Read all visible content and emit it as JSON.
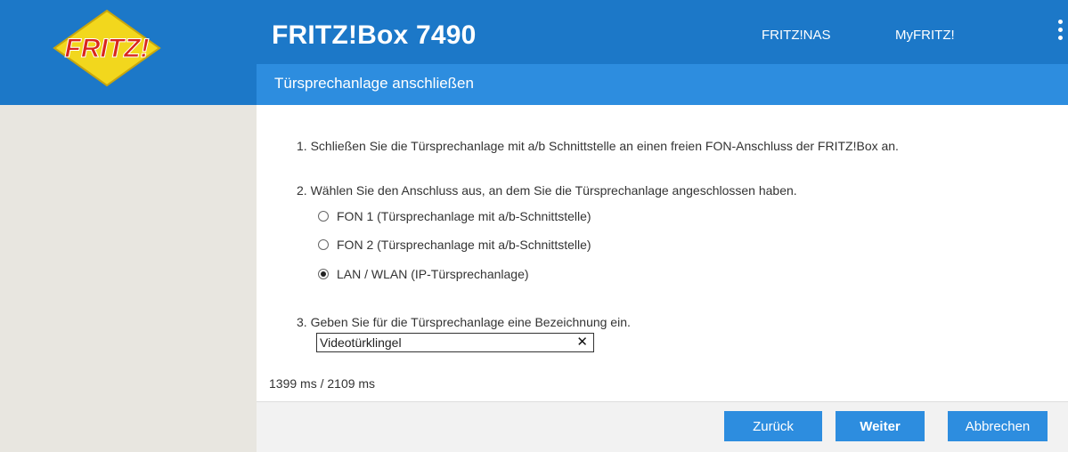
{
  "header": {
    "logo_text": "FRITZ!",
    "product_title": "FRITZ!Box 7490",
    "nav_links": [
      "FRITZ!NAS",
      "MyFRITZ!"
    ]
  },
  "subheader": {
    "title": "Türsprechanlage anschließen"
  },
  "steps": {
    "step1": "1.  Schließen Sie die Türsprechanlage mit a/b Schnittstelle an einen freien FON-Anschluss der FRITZ!Box an.",
    "step2": "2.  Wählen Sie den Anschluss aus, an dem Sie die Türsprechanlage angeschlossen haben.",
    "step3": "3.  Geben Sie für die Türsprechanlage eine Bezeichnung ein."
  },
  "options": [
    {
      "label": "FON 1 (Türsprechanlage mit a/b-Schnittstelle)",
      "selected": false
    },
    {
      "label": "FON 2 (Türsprechanlage mit a/b-Schnittstelle)",
      "selected": false
    },
    {
      "label": "LAN / WLAN (IP-Türsprechanlage)",
      "selected": true
    }
  ],
  "name_field": {
    "value": "Videotürklingel",
    "clear_symbol": "✕"
  },
  "timing": "1399 ms / 2109 ms",
  "buttons": {
    "back": "Zurück",
    "next": "Weiter",
    "cancel": "Abbrechen"
  },
  "colors": {
    "header": "#1c78c8",
    "subheader": "#2d8ddf",
    "button": "#2d8ddf",
    "sidebar": "#e8e6e0"
  },
  "icons": {
    "logo": "fritz-logo-icon",
    "menu": "more-vertical-icon",
    "clear": "close-icon"
  }
}
